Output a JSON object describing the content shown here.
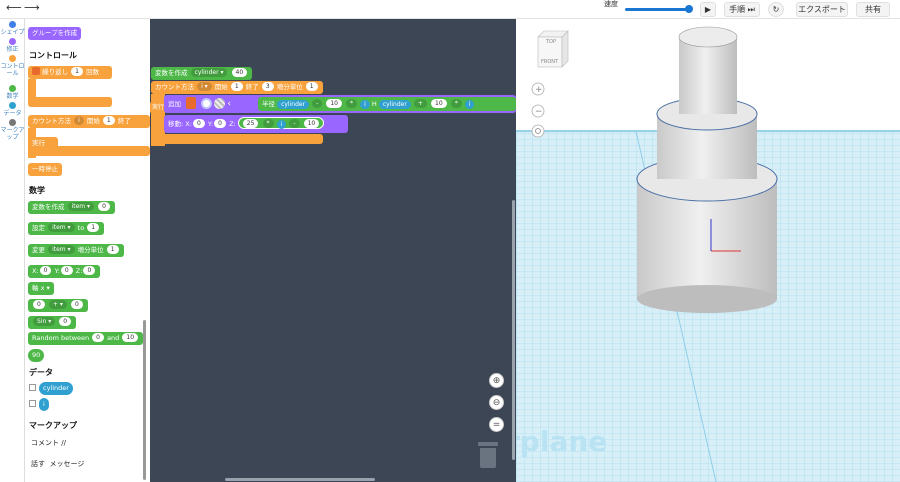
{
  "topbar": {
    "speed_label": "速度",
    "step_label": "手順",
    "export_label": "エクスポート",
    "share_label": "共有"
  },
  "categories": [
    {
      "label": "シェイプ",
      "color": "#3f7fe8"
    },
    {
      "label": "修正",
      "color": "#9966ff"
    },
    {
      "label": "コントロール",
      "color": "#f7a23d"
    },
    {
      "label": "数学",
      "color": "#4db848"
    },
    {
      "label": "データ",
      "color": "#2fa0cf"
    },
    {
      "label": "マークアップ",
      "color": "#777777"
    }
  ],
  "palette": {
    "group_button": "グループを作成",
    "section_control": "コントロール",
    "repeat": {
      "label": "繰り返し",
      "count": "1",
      "unit": "回数"
    },
    "count_with": {
      "label": "カウント方法",
      "var": "i",
      "start_label": "開始",
      "start": "1",
      "end_label": "終了"
    },
    "do_label": "実行",
    "pause": "一時停止",
    "section_math": "数学",
    "create_var": {
      "label": "変数を作成",
      "var": "item",
      "value": "0"
    },
    "set_var": {
      "label": "設定",
      "var": "item",
      "to": "to",
      "value": "1"
    },
    "change_var": {
      "label": "変更",
      "var": "item",
      "by": "増分単位",
      "value": "1"
    },
    "xyz": {
      "x": "X:",
      "xv": "0",
      "y": "Y:",
      "yv": "0",
      "z": "Z:",
      "zv": "0"
    },
    "axis": "軸 x",
    "arith": {
      "a": "0",
      "op": "+",
      "b": "0"
    },
    "sin": {
      "fn": "Sin",
      "value": "0"
    },
    "random": {
      "label": "Random between",
      "from": "0",
      "and": "and",
      "to": "10"
    },
    "number": "90",
    "section_data": "データ",
    "data_vars": [
      "cylinder",
      "i"
    ],
    "section_markup": "マークアップ",
    "comment": "コメント //",
    "say": {
      "label": "話す",
      "message": "メッセージ"
    }
  },
  "workspace": {
    "create_var": {
      "label": "変数を作成",
      "var": "cylinder",
      "value": "40"
    },
    "count_with": {
      "label": "カウント方法",
      "var": "i",
      "start_label": "開始",
      "start": "1",
      "end_label": "終了",
      "end": "3",
      "step_label": "増分単位",
      "step": "1"
    },
    "do_label": "実行",
    "add_label": "追加",
    "radius_label": "半径",
    "radius_var": "cylinder",
    "radius_op": "-",
    "radius_num": "10",
    "radius_op2": "*",
    "radius_i": "i",
    "h_label": "H",
    "h_var": "cylinder",
    "h_op": "+",
    "h_num": "10",
    "h_op2": "*",
    "h_i": "i",
    "move_label": "移動:",
    "mx": "X:",
    "mxv": "0",
    "my": "Y:",
    "myv": "0",
    "mz": "Z:",
    "mz_a": "25",
    "mz_op": "*",
    "mz_i": "i",
    "mz_op2": "-",
    "mz_b": "10"
  },
  "view3d": {
    "cube_top": "TOP",
    "cube_front": "FRONT",
    "plane_label": "rplane",
    "grid_color": "#a8dcf0"
  }
}
